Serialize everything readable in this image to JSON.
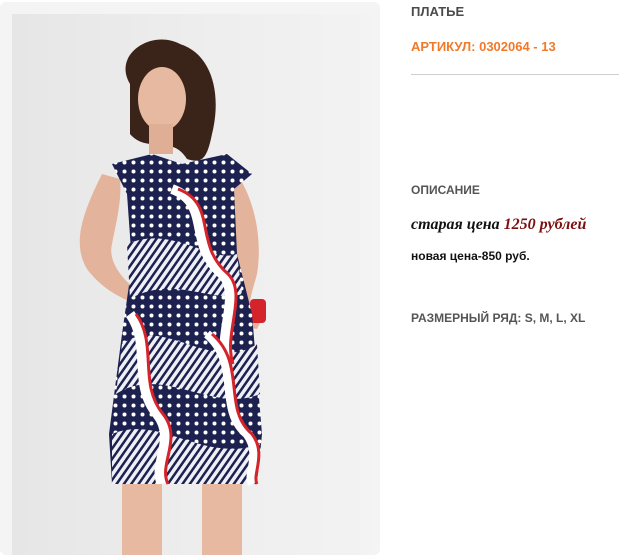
{
  "product": {
    "title": "ПЛАТЬЕ",
    "sku": "АРТИКУЛ: 0302064 - 13",
    "description_label": "ОПИСАНИЕ",
    "old_price_label": "старая цена",
    "old_price_value": "1250 рублей",
    "new_price": "новая цена-850 руб.",
    "sizes": "РАЗМЕРНЫЙ РЯД: S, M, L, XL"
  },
  "colors": {
    "accent": "#f07a2a",
    "old_price": "#7a1010",
    "dress_navy": "#1c2150",
    "dress_red": "#d4232b"
  }
}
